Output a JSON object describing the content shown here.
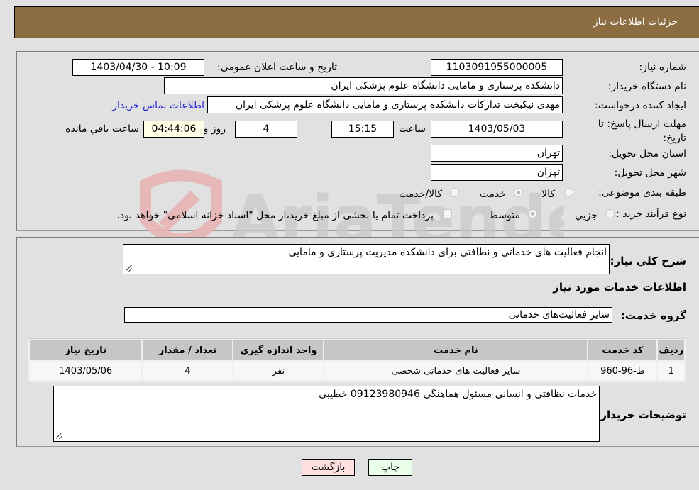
{
  "header": {
    "title": "جزئیات اطلاعات نیاز"
  },
  "form": {
    "need_number": {
      "label": "شماره نیاز:",
      "value": "1103091955000005"
    },
    "announce_datetime": {
      "label": "تاریخ و ساعت اعلان عمومی:",
      "value": "1403/04/30 - 10:09"
    },
    "buyer_org": {
      "label": "نام دستگاه خریدار:",
      "value": "دانشکده پرستاری و مامایی دانشگاه علوم پزشکی ایران"
    },
    "requester": {
      "label": "ایجاد کننده درخواست:",
      "value": "مهدی نیکبخت تدارکات  دانشکده پرستاری و مامایی دانشگاه علوم پزشکی ایران"
    },
    "buyer_contact_link": "اطلاعات تماس خریدار",
    "deadline": {
      "label": "مهلت ارسال پاسخ: تا تاریخ:",
      "date": "1403/05/03",
      "time_label": "ساعت",
      "time": "15:15",
      "days": "4",
      "days_label": "روز و",
      "remaining": "04:44:06",
      "remaining_label": "ساعت باقي مانده"
    },
    "province": {
      "label": "استان محل تحویل:",
      "value": "تهران"
    },
    "city": {
      "label": "شهر محل تحویل:",
      "value": "تهران"
    },
    "category": {
      "label": "طبقه بندی موضوعی:",
      "options": [
        "کالا",
        "خدمت",
        "کالا/خدمت"
      ],
      "selected": "خدمت"
    },
    "purchase_type": {
      "label": "نوع فرآیند خرید :",
      "options": [
        "جزيي",
        "متوسط"
      ],
      "selected": "متوسط",
      "treasury_note": "پرداخت تمام یا بخشی از مبلغ خرید،از محل \"اسناد خزانه اسلامی\" خواهد بود."
    }
  },
  "details": {
    "description_label": "شرح كلي نياز:",
    "description": "انجام فعالیت های خدماتی و نظافتی برای دانشکده مدیریت پرستاری و مامایی",
    "services_heading": "اطلاعات خدمات مورد نياز",
    "service_group_label": "گروه خدمت:",
    "service_group": "سایر فعالیت‌های خدماتی",
    "table": {
      "headers": [
        "ردیف",
        "کد خدمت",
        "نام خدمت",
        "واحد اندازه گیری",
        "تعداد / مقدار",
        "تاریخ نیاز"
      ],
      "rows": [
        [
          "1",
          "ط-96-960",
          "سایر فعالیت های خدماتی شخصی",
          "نفر",
          "4",
          "1403/05/06"
        ]
      ]
    },
    "buyer_notes_label": "توضیحات خریدار:",
    "buyer_notes": "خدمات نظافتی و انسانی  مسئول هماهنگی 09123980946 خطیبی"
  },
  "buttons": {
    "print": "چاپ",
    "back": "بازگشت"
  },
  "watermark": "AriaTender.net",
  "colors": {
    "header_bg": "#8c6d42",
    "print_bg": "#eaffea",
    "back_bg": "#ffe0e0",
    "link": "#2a2ad8"
  }
}
